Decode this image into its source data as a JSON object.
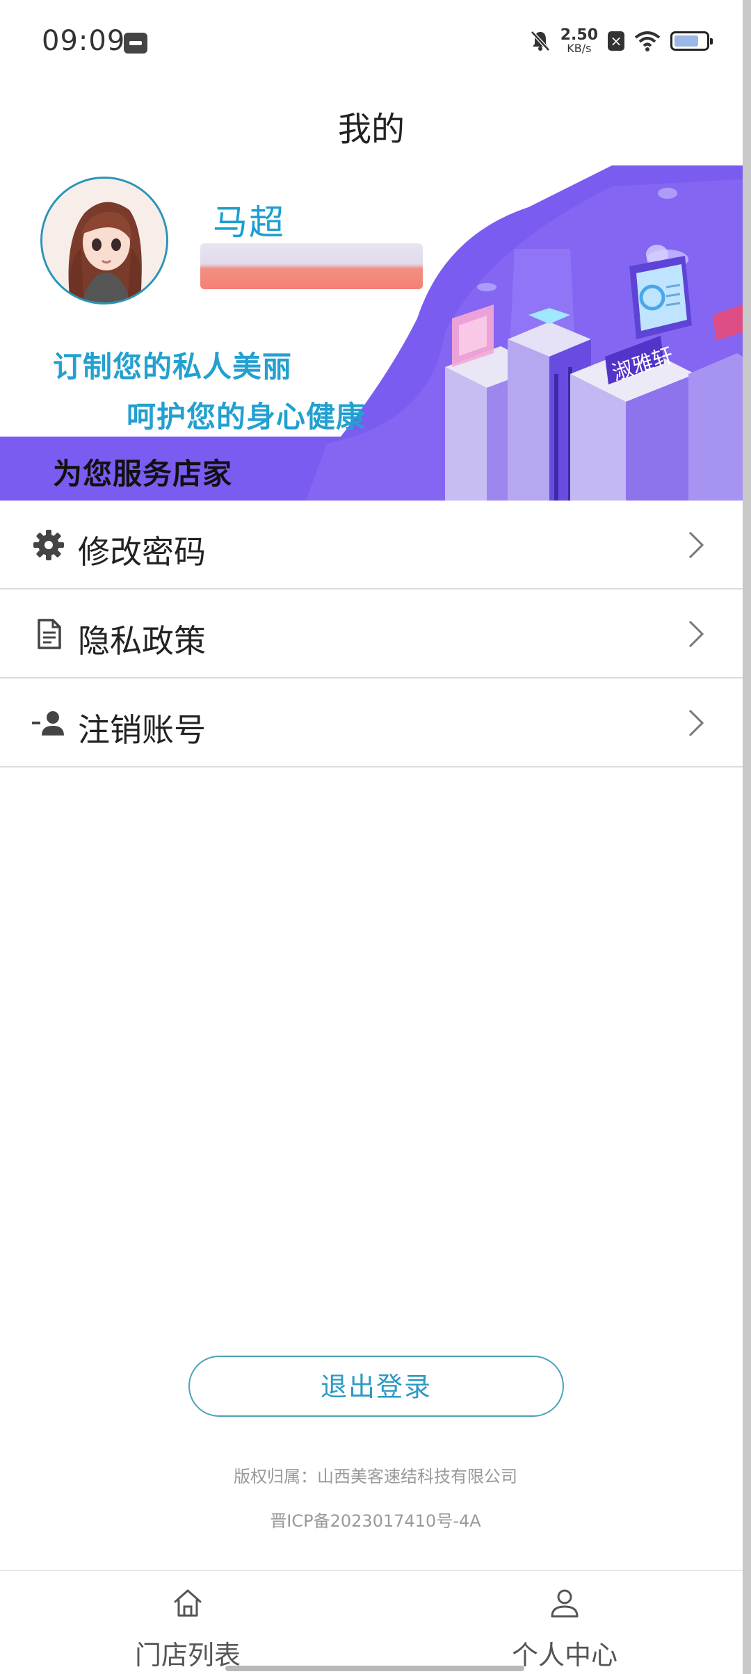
{
  "status_bar": {
    "time": "09:09",
    "net_speed_value": "2.50",
    "net_speed_unit": "KB/s",
    "icons": [
      "app-notification-icon",
      "bell-muted-icon",
      "close-box-icon",
      "wifi-icon",
      "battery-icon"
    ]
  },
  "header": {
    "title": "我的"
  },
  "profile": {
    "name": "马超",
    "slogan_line1": "订制您的私人美丽",
    "slogan_line2": "呵护您的身心健康",
    "service_label": "为您服务店家",
    "sign_text": "淑雅轩"
  },
  "menu": {
    "items": [
      {
        "label": "修改密码",
        "icon": "gear-icon"
      },
      {
        "label": "隐私政策",
        "icon": "document-icon"
      },
      {
        "label": "注销账号",
        "icon": "remove-user-icon"
      }
    ]
  },
  "logout": {
    "label": "退出登录"
  },
  "footer": {
    "copyright": "版权归属：山西美客速结科技有限公司",
    "icp": "晋ICP备2023017410号-4A"
  },
  "tabbar": {
    "tabs": [
      {
        "label": "门店列表",
        "icon": "home-icon"
      },
      {
        "label": "个人中心",
        "icon": "user-icon"
      }
    ]
  },
  "colors": {
    "accent_blue": "#23a0d0",
    "banner_purple": "#7b5cf0",
    "button_border": "#4aa3b8"
  }
}
